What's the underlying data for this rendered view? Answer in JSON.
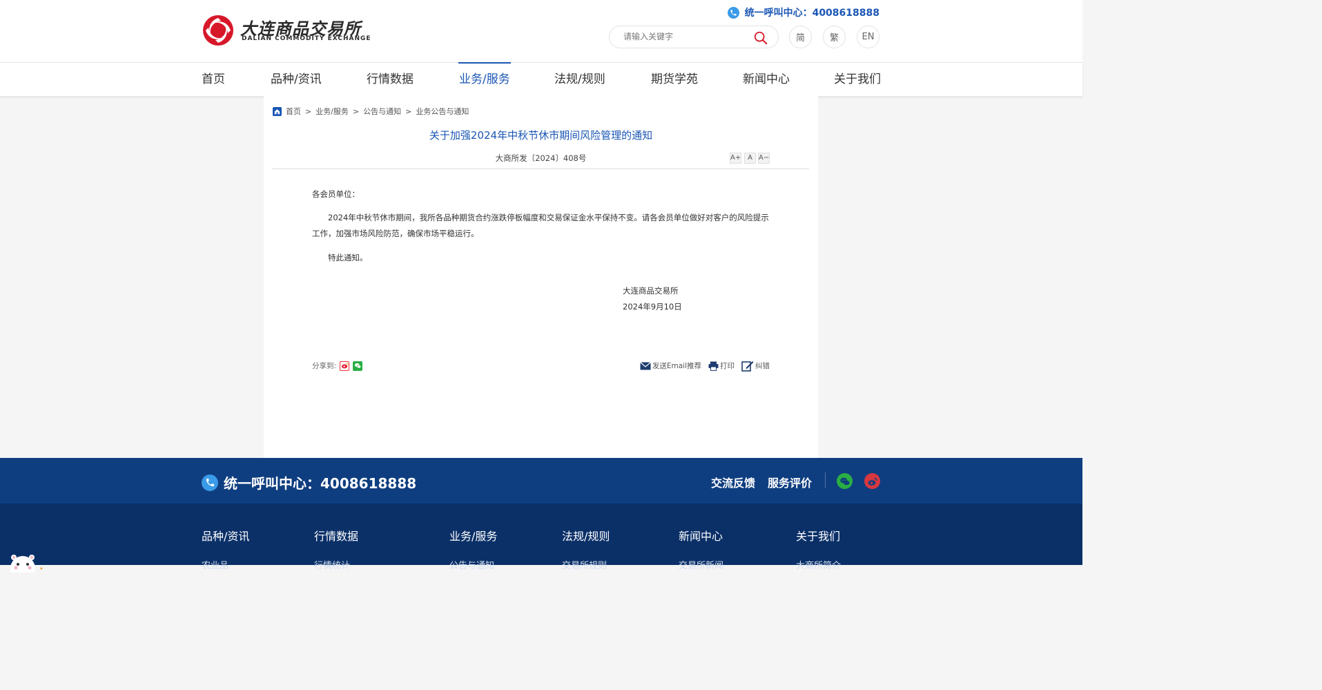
{
  "header": {
    "logo_cn": "大连商品交易所",
    "logo_en": "DALIAN COMMODITY EXCHANGE",
    "hotline": "统一呼叫中心：4008618888",
    "search_placeholder": "请输入关键字",
    "lang": {
      "simplified": "简",
      "traditional": "繁",
      "english": "EN"
    }
  },
  "nav": {
    "items": [
      {
        "label": "首页"
      },
      {
        "label": "品种/资讯"
      },
      {
        "label": "行情数据"
      },
      {
        "label": "业务/服务"
      },
      {
        "label": "法规/规则"
      },
      {
        "label": "期货学苑"
      },
      {
        "label": "新闻中心"
      },
      {
        "label": "关于我们"
      }
    ],
    "active": "业务/服务"
  },
  "breadcrumb": {
    "items": [
      "首页",
      "业务/服务",
      "公告与通知",
      "业务公告与通知"
    ],
    "sep": ">"
  },
  "article": {
    "title": "关于加强2024年中秋节休市期间风险管理的通知",
    "doc_no": "大商所发〔2024〕408号",
    "font_controls": {
      "larger": "A+",
      "normal": "A",
      "smaller": "A−"
    },
    "salutation": "各会员单位：",
    "paragraph": "2024年中秋节休市期间，我所各品种期货合约涨跌停板幅度和交易保证金水平保持不变。请各会员单位做好对客户的风险提示工作，加强市场风险防范，确保市场平稳运行。",
    "closing": "特此通知。",
    "signer": "大连商品交易所",
    "date": "2024年9月10日"
  },
  "share": {
    "label": "分享到:"
  },
  "tools": {
    "email": "发送Email推荐",
    "print": "打印",
    "correct": "纠错"
  },
  "footer": {
    "hotline": "统一呼叫中心：4008618888",
    "feedback": "交流反馈",
    "evaluation": "服务评价",
    "categories": [
      "品种/资讯",
      "行情数据",
      "业务/服务",
      "法规/规则",
      "新闻中心",
      "关于我们"
    ],
    "subs": [
      "农业品",
      "行情统计",
      "公告与通知",
      "交易所规则",
      "交易所新闻",
      "大商所简介"
    ]
  },
  "colors": {
    "brand_blue": "#1a56b4",
    "footer_top": "#0f3e80",
    "footer_bottom": "#0b3068",
    "logo_red": "#d7182a"
  }
}
